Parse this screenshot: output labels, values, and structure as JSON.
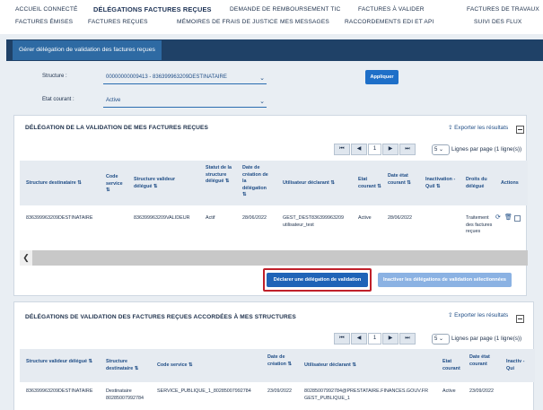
{
  "nav": {
    "row1": [
      "Accueil connecté",
      "Délégations factures reçues",
      "Demande de remboursement TIC",
      "Factures à valider",
      "Factures de travaux"
    ],
    "row2": [
      "Factures émises",
      "Factures reçues",
      "Mémoires de frais de justice",
      "Mes messages",
      "Raccordements EDI et API",
      "Suivi des flux"
    ]
  },
  "subtab": "Gérer délégation de validation des factures reçues",
  "filters": {
    "structure_label": "Structure :",
    "structure_value": "00000000009413 - 836399963209DESTINATAIRE",
    "etat_label": "Etat courant :",
    "etat_value": "Active",
    "apply_label": "Appliquer"
  },
  "card1": {
    "title": "DÉLÉGATION DE LA VALIDATION DE MES FACTURES REÇUES",
    "export": "Exporter les résultats",
    "pager": {
      "first": "⏮",
      "prev": "◀",
      "page": "1",
      "next": "▶",
      "last": "⏭"
    },
    "perpage_value": "5",
    "perpage_text": "Lignes par page (1 ligne(s))",
    "columns": [
      "Structure destinataire ⇅",
      "Code service ⇅",
      "Structure valideur délégué ⇅",
      "Statut de la structure délégué ⇅",
      "Date de création de la délégation ⇅",
      "Utilisateur déclarant ⇅",
      "Etat courant ⇅",
      "Date état courant ⇅",
      "Inactivation - Quil ⇅",
      "Droits du délégué",
      "Actions"
    ],
    "row": {
      "dest": "836399963209DESTINATAIRE",
      "code": "",
      "valideur": "836399963209VALIDEUR",
      "statut": "Actif",
      "date_creation": "28/06/2022",
      "user": "GEST_DEST836399963209 utilisateur_test",
      "etat": "Active",
      "date_etat": "28/06/2022",
      "inactivation": "",
      "droits": "Traitement des factures reçues"
    },
    "declare_label": "Déclarer une délégation de validation",
    "inactivate_label": "Inactiver les délégations de validation sélectionnées"
  },
  "card2": {
    "title": "DÉLÉGATIONS DE VALIDATION DES FACTURES REÇUES ACCORDÉES À MES STRUCTURES",
    "export": "Exporter les résultats",
    "pager": {
      "first": "⏮",
      "prev": "◀",
      "page": "1",
      "next": "▶",
      "last": "⏭"
    },
    "perpage_value": "5",
    "perpage_text": "Lignes par page (1 ligne(s))",
    "columns": [
      "Structure valideur délégué ⇅",
      "Structure destinataire ⇅",
      "Code service ⇅",
      "Date de création ⇅",
      "Utilisateur déclarant ⇅",
      "Etat courant",
      "Date état courant",
      "Inactiv - Qui"
    ],
    "row": {
      "valideur": "836399963209DESTINATAIRE",
      "dest": "Destinataire 80285007992784",
      "code": "SERVICE_PUBLIQUE_1_80285007992784",
      "date": "23/09/2022",
      "user": "80285007992784@PRESTATAIRE.FINANCES.GOUV.FR GEST_PUBLIQUE_1",
      "etat": "Active",
      "date_etat": "23/09/2022"
    }
  },
  "colors": {
    "navy": "#1f4167",
    "accent": "#2e6aa3",
    "primary": "#1e6fc8",
    "highlight": "#c0202a"
  }
}
